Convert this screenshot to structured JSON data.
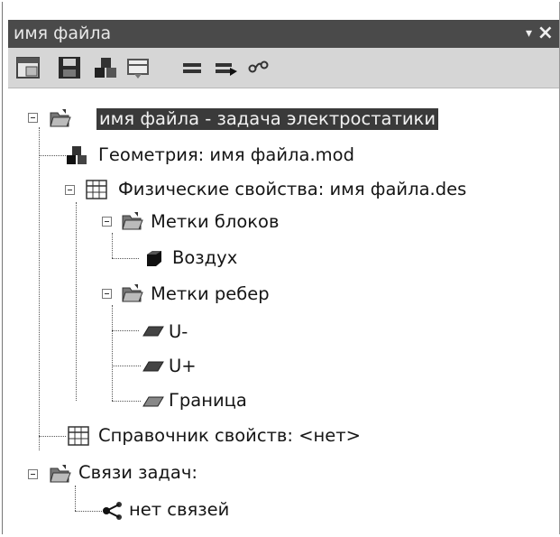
{
  "window": {
    "title": "имя файла",
    "pin_glyph": "▾",
    "close_glyph": "×"
  },
  "toolbar": {
    "buttons": [
      {
        "icon": "open-window-icon"
      },
      {
        "icon": "save-icon"
      },
      {
        "icon": "geometry-icon"
      },
      {
        "icon": "properties-icon"
      },
      {
        "icon": "equals-icon"
      },
      {
        "icon": "equals-arrow-icon"
      },
      {
        "icon": "link-icon"
      }
    ]
  },
  "tree": {
    "root_label": "имя файла - задача электростатики",
    "geometry_label": "Геометрия: имя файла.mod",
    "physics_label": "Физические свойства: имя файла.des",
    "block_labels_folder": "Метки блоков",
    "block_air": "Воздух",
    "edge_labels_folder": "Метки ребер",
    "edge_u_minus": "U-",
    "edge_u_plus": "U+",
    "edge_boundary": "Граница",
    "reference_label": "Справочник свойств: <нет>",
    "links_label": "Связи задач:",
    "no_links": "нет связей"
  },
  "colors": {
    "titlebar": "#4a4a4a",
    "toolbar": "#d6d6d6",
    "selection": "#3a3a3a"
  }
}
